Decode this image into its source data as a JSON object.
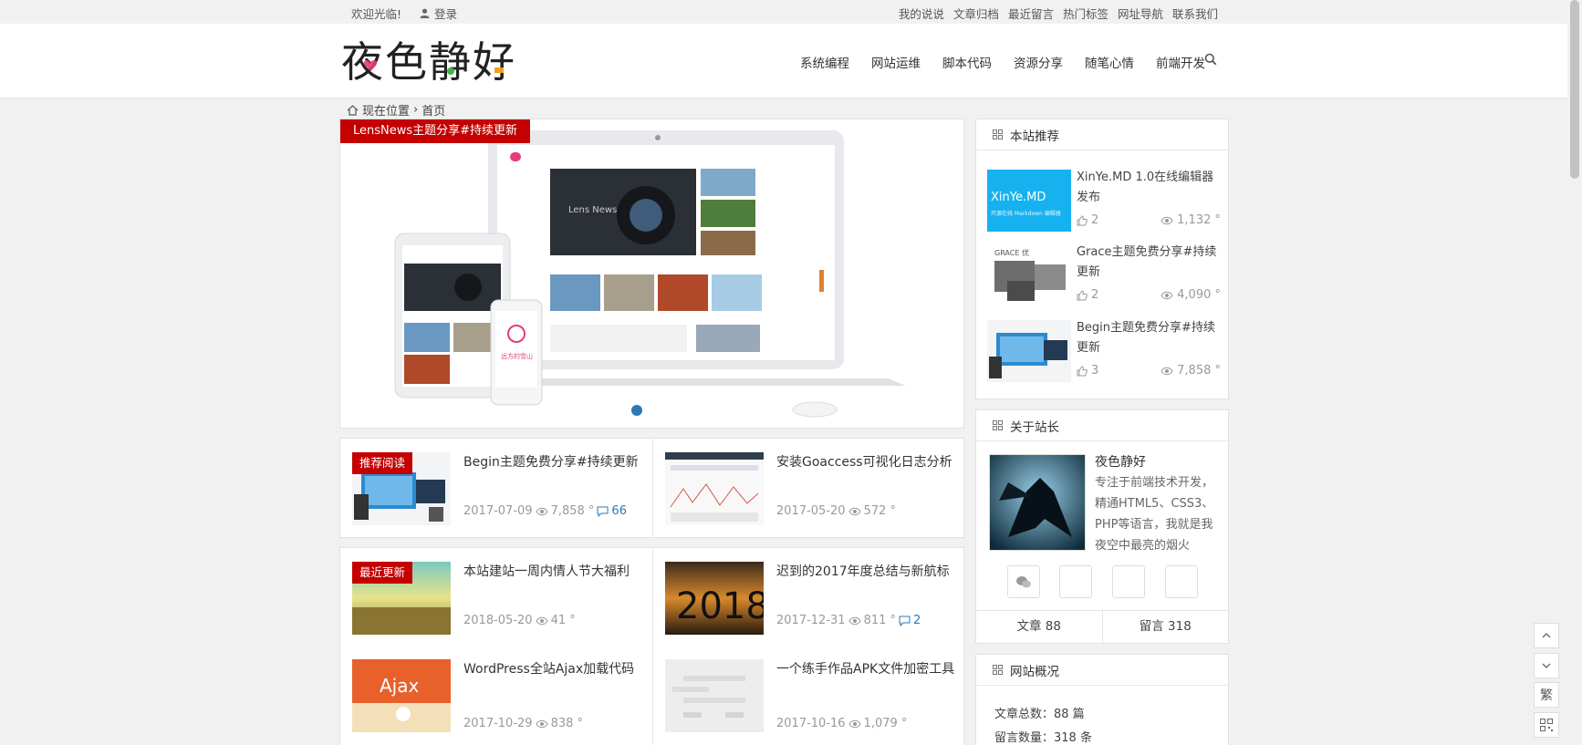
{
  "topbar": {
    "welcome": "欢迎光临!",
    "login": "登录",
    "links": [
      "我的说说",
      "文章归档",
      "最近留言",
      "热门标签",
      "网址导航",
      "联系我们"
    ]
  },
  "header": {
    "logo_text": "夜色静好",
    "nav": [
      "系统编程",
      "网站运维",
      "脚本代码",
      "资源分享",
      "随笔心情",
      "前端开发"
    ]
  },
  "breadcrumb": {
    "label": "现在位置",
    "current": "首页"
  },
  "slider": {
    "caption": "LensNews主题分享#持续更新",
    "screen_brand": "Lens News",
    "phone_text": "远方的雪山"
  },
  "posts": [
    {
      "badge": "推荐阅读",
      "title": "Begin主题免费分享#持续更新",
      "date": "2017-07-09",
      "views": "7,858 °",
      "comments": "66"
    },
    {
      "badge": "",
      "title": "安装Goaccess可视化日志分析",
      "date": "2017-05-20",
      "views": "572 °",
      "comments": ""
    },
    {
      "badge": "最近更新",
      "title": "本站建站一周内情人节大福利",
      "date": "2018-05-20",
      "views": "41 °",
      "comments": ""
    },
    {
      "badge": "",
      "title": "迟到的2017年度总结与新航标",
      "date": "2017-12-31",
      "views": "811 °",
      "comments": "2",
      "thumb_text": "2018"
    },
    {
      "badge": "",
      "title": "WordPress全站Ajax加载代码",
      "date": "2017-10-29",
      "views": "838 °",
      "comments": "",
      "thumb_text": "Ajax"
    },
    {
      "badge": "",
      "title": "一个练手作品APK文件加密工具",
      "date": "2017-10-16",
      "views": "1,079 °",
      "comments": ""
    }
  ],
  "recommend": {
    "title": "本站推荐",
    "items": [
      {
        "title": "XinYe.MD 1.0在线编辑器发布",
        "likes": "2",
        "views": "1,132 °",
        "thumb_text": "XinYe.MD",
        "thumb_sub": "开源在线 Markdown 编辑器"
      },
      {
        "title": "Grace主题免费分享#持续更新",
        "likes": "2",
        "views": "4,090 °",
        "thumb_text": "GRACE 优"
      },
      {
        "title": "Begin主题免费分享#持续更新",
        "likes": "3",
        "views": "7,858 °",
        "thumb_text": ""
      }
    ]
  },
  "about": {
    "title": "关于站长",
    "name": "夜色静好",
    "desc": "专注于前端技术开发，精通HTML5、CSS3、PHP等语言，我就是我夜空中最亮的烟火",
    "articles": "文章 88",
    "comments": "留言 318"
  },
  "overview": {
    "title": "网站概况",
    "rows": [
      "文章总数：88 篇",
      "留言数量：318 条"
    ]
  },
  "float": {
    "trad": "繁"
  }
}
